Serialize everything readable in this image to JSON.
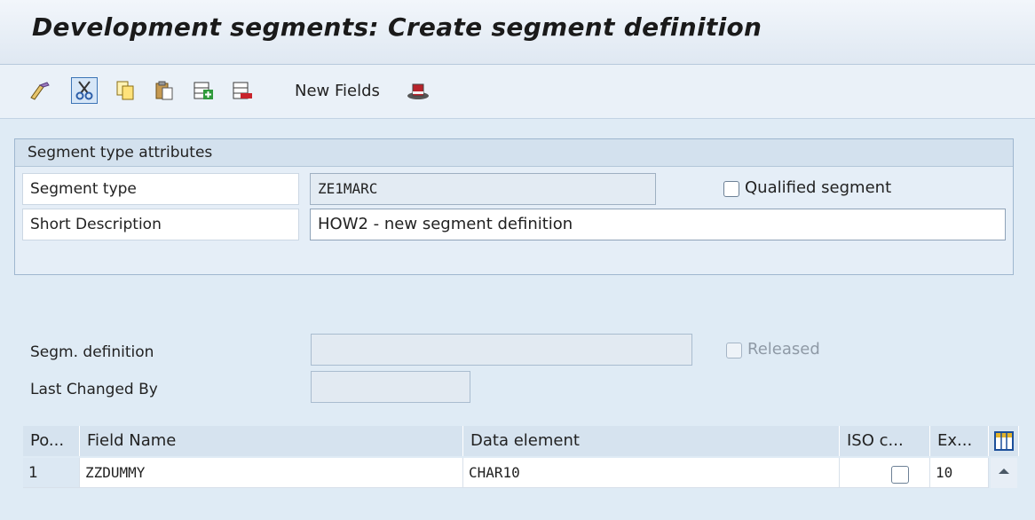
{
  "window": {
    "title": "Development segments: Create segment definition"
  },
  "toolbar": {
    "new_fields_label": "New Fields",
    "icons": [
      "pencil-icon",
      "cut-icon",
      "copy-icon",
      "paste-icon",
      "insert-row-icon",
      "delete-row-icon",
      "hat-icon"
    ]
  },
  "segment_attributes": {
    "group_title": "Segment type attributes",
    "segment_type_label": "Segment type",
    "segment_type_value": "ZE1MARC",
    "qualified_label": "Qualified segment",
    "qualified_checked": false,
    "short_desc_label": "Short Description",
    "short_desc_value": "HOW2 - new segment definition"
  },
  "definition": {
    "segm_def_label": "Segm. definition",
    "segm_def_value": "",
    "released_label": "Released",
    "released_checked": false,
    "last_changed_label": "Last Changed By",
    "last_changed_value": ""
  },
  "fields_table": {
    "columns": [
      "Po...",
      "Field Name",
      "Data element",
      "ISO c...",
      "Ex..."
    ],
    "rows": [
      {
        "pos": "1",
        "field_name": "ZZDUMMY",
        "data_element": "CHAR10",
        "iso": false,
        "ext": "10"
      }
    ]
  },
  "colors": {
    "background": "#dfebf5",
    "header": "#d6e3ef",
    "accent": "#3c74b6"
  }
}
